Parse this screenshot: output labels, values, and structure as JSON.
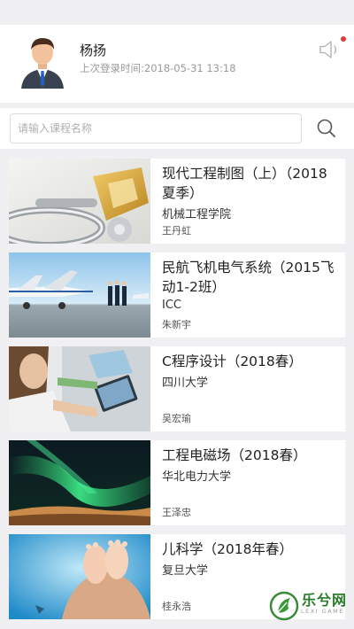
{
  "profile": {
    "name": "杨扬",
    "last_login_label": "上次登录时间:",
    "last_login_value": "2018-05-31 13:18"
  },
  "search": {
    "placeholder": "请输入课程名称"
  },
  "courses": [
    {
      "title": "现代工程制图（上）（2018夏季）",
      "school": "机械工程学院",
      "teacher": "王丹虹",
      "thumb": "engineering-parts"
    },
    {
      "title": "民航飞机电气系统（2015飞动1-2班）",
      "school": "ICC",
      "teacher": "朱新宇",
      "thumb": "airplane"
    },
    {
      "title": "C程序设计（2018春）",
      "school": "四川大学",
      "teacher": "吴宏瑜",
      "thumb": "students-tablet"
    },
    {
      "title": "工程电磁场（2018春）",
      "school": "华北电力大学",
      "teacher": "王泽忠",
      "thumb": "aurora"
    },
    {
      "title": "儿科学（2018年春）",
      "school": "复旦大学",
      "teacher": "桂永浩",
      "thumb": "baby-feet"
    }
  ],
  "watermark": {
    "title": "乐兮网",
    "subtitle": "LEXI GAME"
  },
  "colors": {
    "background": "#f0f0f2",
    "notification_dot": "#e53935",
    "watermark_green": "#2a7a2a"
  }
}
